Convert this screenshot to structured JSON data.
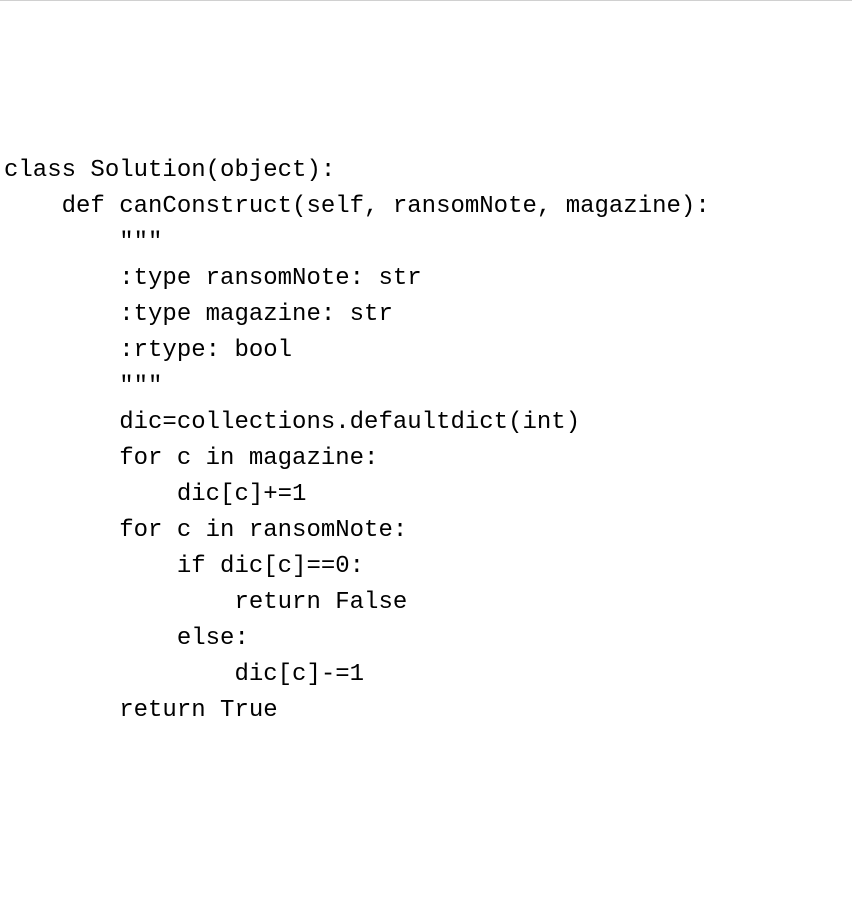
{
  "code": {
    "language": "python",
    "lines": [
      "class Solution(object):",
      "    def canConstruct(self, ransomNote, magazine):",
      "        \"\"\"",
      "        :type ransomNote: str",
      "        :type magazine: str",
      "        :rtype: bool",
      "        \"\"\"",
      "        dic=collections.defaultdict(int)",
      "        for c in magazine:",
      "            dic[c]+=1",
      "        for c in ransomNote:",
      "            if dic[c]==0:",
      "                return False",
      "            else:",
      "                dic[c]-=1",
      "        return True"
    ]
  }
}
